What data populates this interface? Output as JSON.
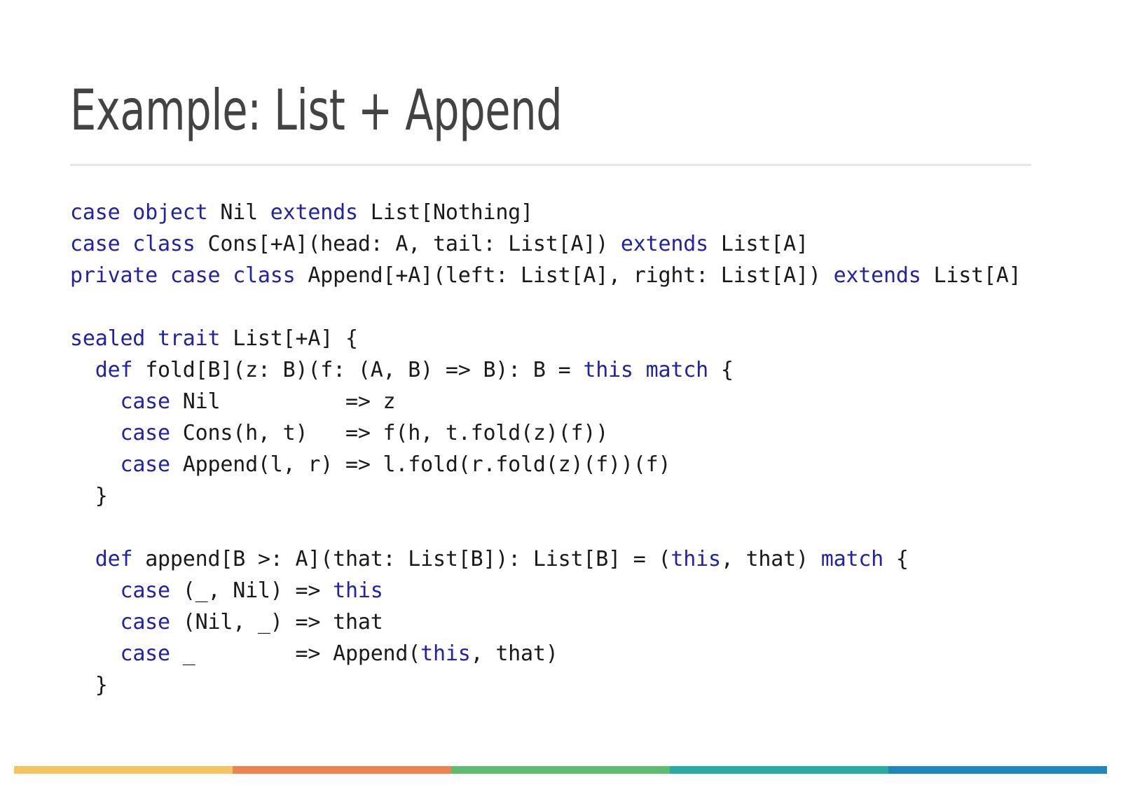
{
  "slide": {
    "title": "Example: List + Append",
    "background_color": "#FFFFFF",
    "title_color": "#434343",
    "rule_color": "#E6E6E6"
  },
  "code": {
    "keyword_color": "#2222A8",
    "text_color": "#1A1A1A",
    "language": "scala",
    "lines": [
      {
        "index": 0,
        "text": "case object Nil extends List[Nothing]",
        "tokens": [
          {
            "t": "case object ",
            "kw": true
          },
          {
            "t": "Nil ",
            "kw": false
          },
          {
            "t": "extends ",
            "kw": true
          },
          {
            "t": "List[Nothing]",
            "kw": false
          }
        ]
      },
      {
        "index": 1,
        "text": "case class Cons[+A](head: A, tail: List[A]) extends List[A]",
        "tokens": [
          {
            "t": "case class ",
            "kw": true
          },
          {
            "t": "Cons[+A](head: A, tail: List[A]) ",
            "kw": false
          },
          {
            "t": "extends ",
            "kw": true
          },
          {
            "t": "List[A]",
            "kw": false
          }
        ]
      },
      {
        "index": 2,
        "text": "private case class Append[+A](left: List[A], right: List[A]) extends List[A]",
        "tokens": [
          {
            "t": "private case class ",
            "kw": true
          },
          {
            "t": "Append[+A](left: List[A], right: List[A]) ",
            "kw": false
          },
          {
            "t": "extends ",
            "kw": true
          },
          {
            "t": "List[A]",
            "kw": false
          }
        ]
      },
      {
        "index": 3,
        "text": "",
        "tokens": []
      },
      {
        "index": 4,
        "text": "sealed trait List[+A] {",
        "tokens": [
          {
            "t": "sealed trait ",
            "kw": true
          },
          {
            "t": "List[+A] {",
            "kw": false
          }
        ]
      },
      {
        "index": 5,
        "text": "  def fold[B](z: B)(f: (A, B) => B): B = this match {",
        "tokens": [
          {
            "t": "  ",
            "kw": false
          },
          {
            "t": "def ",
            "kw": true
          },
          {
            "t": "fold[B](z: B)(f: (A, B) => B): B = ",
            "kw": false
          },
          {
            "t": "this match ",
            "kw": true
          },
          {
            "t": "{",
            "kw": false
          }
        ]
      },
      {
        "index": 6,
        "text": "    case Nil          => z",
        "tokens": [
          {
            "t": "    ",
            "kw": false
          },
          {
            "t": "case ",
            "kw": true
          },
          {
            "t": "Nil          => z",
            "kw": false
          }
        ]
      },
      {
        "index": 7,
        "text": "    case Cons(h, t)   => f(h, t.fold(z)(f))",
        "tokens": [
          {
            "t": "    ",
            "kw": false
          },
          {
            "t": "case ",
            "kw": true
          },
          {
            "t": "Cons(h, t)   => f(h, t.fold(z)(f))",
            "kw": false
          }
        ]
      },
      {
        "index": 8,
        "text": "    case Append(l, r) => l.fold(r.fold(z)(f))(f)",
        "tokens": [
          {
            "t": "    ",
            "kw": false
          },
          {
            "t": "case ",
            "kw": true
          },
          {
            "t": "Append(l, r) => l.fold(r.fold(z)(f))(f)",
            "kw": false
          }
        ]
      },
      {
        "index": 9,
        "text": "  }",
        "tokens": [
          {
            "t": "  }",
            "kw": false
          }
        ]
      },
      {
        "index": 10,
        "text": "",
        "tokens": []
      },
      {
        "index": 11,
        "text": "  def append[B >: A](that: List[B]): List[B] = (this, that) match {",
        "tokens": [
          {
            "t": "  ",
            "kw": false
          },
          {
            "t": "def ",
            "kw": true
          },
          {
            "t": "append[B >: A](that: List[B]): List[B] = (",
            "kw": false
          },
          {
            "t": "this",
            "kw": true
          },
          {
            "t": ", that) ",
            "kw": false
          },
          {
            "t": "match ",
            "kw": true
          },
          {
            "t": "{",
            "kw": false
          }
        ]
      },
      {
        "index": 12,
        "text": "    case (_, Nil) => this",
        "tokens": [
          {
            "t": "    ",
            "kw": false
          },
          {
            "t": "case ",
            "kw": true
          },
          {
            "t": "(_, Nil) => ",
            "kw": false
          },
          {
            "t": "this",
            "kw": true
          }
        ]
      },
      {
        "index": 13,
        "text": "    case (Nil, _) => that",
        "tokens": [
          {
            "t": "    ",
            "kw": false
          },
          {
            "t": "case ",
            "kw": true
          },
          {
            "t": "(Nil, _) => that",
            "kw": false
          }
        ]
      },
      {
        "index": 14,
        "text": "    case _        => Append(this, that)",
        "tokens": [
          {
            "t": "    ",
            "kw": false
          },
          {
            "t": "case ",
            "kw": true
          },
          {
            "t": "_        => Append(",
            "kw": false
          },
          {
            "t": "this",
            "kw": true
          },
          {
            "t": ", that)",
            "kw": false
          }
        ]
      },
      {
        "index": 15,
        "text": "  }",
        "tokens": [
          {
            "t": "  }",
            "kw": false
          }
        ]
      }
    ]
  },
  "footer_bar": {
    "segments": [
      {
        "name": "yellow",
        "color": "#F2C462"
      },
      {
        "name": "orange",
        "color": "#EC8451"
      },
      {
        "name": "green",
        "color": "#5EBB72"
      },
      {
        "name": "teal",
        "color": "#2BAAA4"
      },
      {
        "name": "blue",
        "color": "#2186BD"
      }
    ]
  }
}
